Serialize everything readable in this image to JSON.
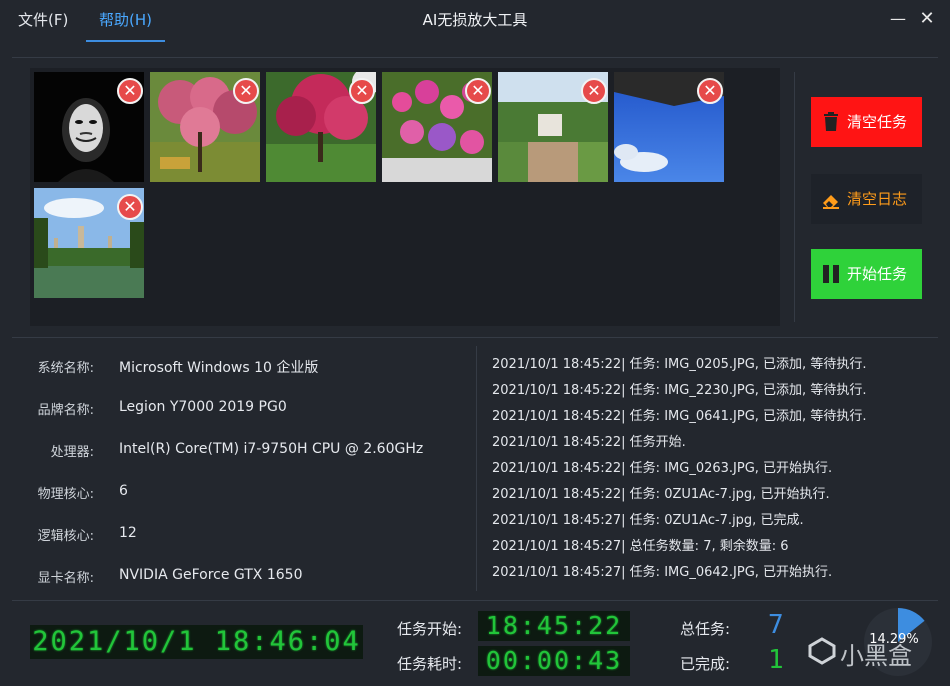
{
  "menu": {
    "file": "文件(F)",
    "help": "帮助(H)"
  },
  "title": "AI无损放大工具",
  "window": {
    "minimize": "—",
    "close": "✕"
  },
  "thumbnails": [
    {
      "name": "mask-photo"
    },
    {
      "name": "blossom-tree-photo"
    },
    {
      "name": "red-maple-photo"
    },
    {
      "name": "pink-flowers-photo"
    },
    {
      "name": "park-path-photo"
    },
    {
      "name": "blue-sky-photo"
    },
    {
      "name": "pagoda-lake-photo"
    }
  ],
  "buttons": {
    "clear_tasks": "清空任务",
    "clear_log": "清空日志",
    "start_tasks": "开始任务"
  },
  "colors": {
    "clear_tasks": "#ff1414",
    "clear_log_text": "#ff9c1a",
    "start_tasks": "#2fd23a",
    "lcd_green": "#22c53a",
    "accent_blue": "#3d8de0"
  },
  "system": [
    {
      "label": "系统名称:",
      "value": "Microsoft Windows 10 企业版"
    },
    {
      "label": "品牌名称:",
      "value": "Legion Y7000 2019 PG0"
    },
    {
      "label": "处理器:",
      "value": "Intel(R) Core(TM) i7-9750H CPU @ 2.60GHz"
    },
    {
      "label": "物理核心:",
      "value": "6"
    },
    {
      "label": "逻辑核心:",
      "value": "12"
    },
    {
      "label": "显卡名称:",
      "value": "NVIDIA GeForce GTX 1650"
    }
  ],
  "log": [
    "2021/10/1 18:45:22| 任务: IMG_0205.JPG, 已添加, 等待执行.",
    "2021/10/1 18:45:22| 任务: IMG_2230.JPG, 已添加, 等待执行.",
    "2021/10/1 18:45:22| 任务: IMG_0641.JPG, 已添加, 等待执行.",
    "2021/10/1 18:45:22| 任务开始.",
    "2021/10/1 18:45:22| 任务: IMG_0263.JPG, 已开始执行.",
    "2021/10/1 18:45:22| 任务: 0ZU1Ac-7.jpg, 已开始执行.",
    "2021/10/1 18:45:27| 任务: 0ZU1Ac-7.jpg, 已完成.",
    "2021/10/1 18:45:27| 总任务数量: 7, 剩余数量: 6",
    "2021/10/1 18:45:27| 任务: IMG_0642.JPG, 已开始执行."
  ],
  "status": {
    "clock": "2021/10/1  18:46:04",
    "start_label": "任务开始:",
    "start_time": "18:45:22",
    "elapsed_label": "任务耗时:",
    "elapsed_time": "00:00:43",
    "total_label": "总任务:",
    "total_value": "7",
    "done_label": "已完成:",
    "done_value": "1",
    "progress_percent": 14.29,
    "progress_label": "14.29%"
  },
  "watermark": "小黑盒"
}
